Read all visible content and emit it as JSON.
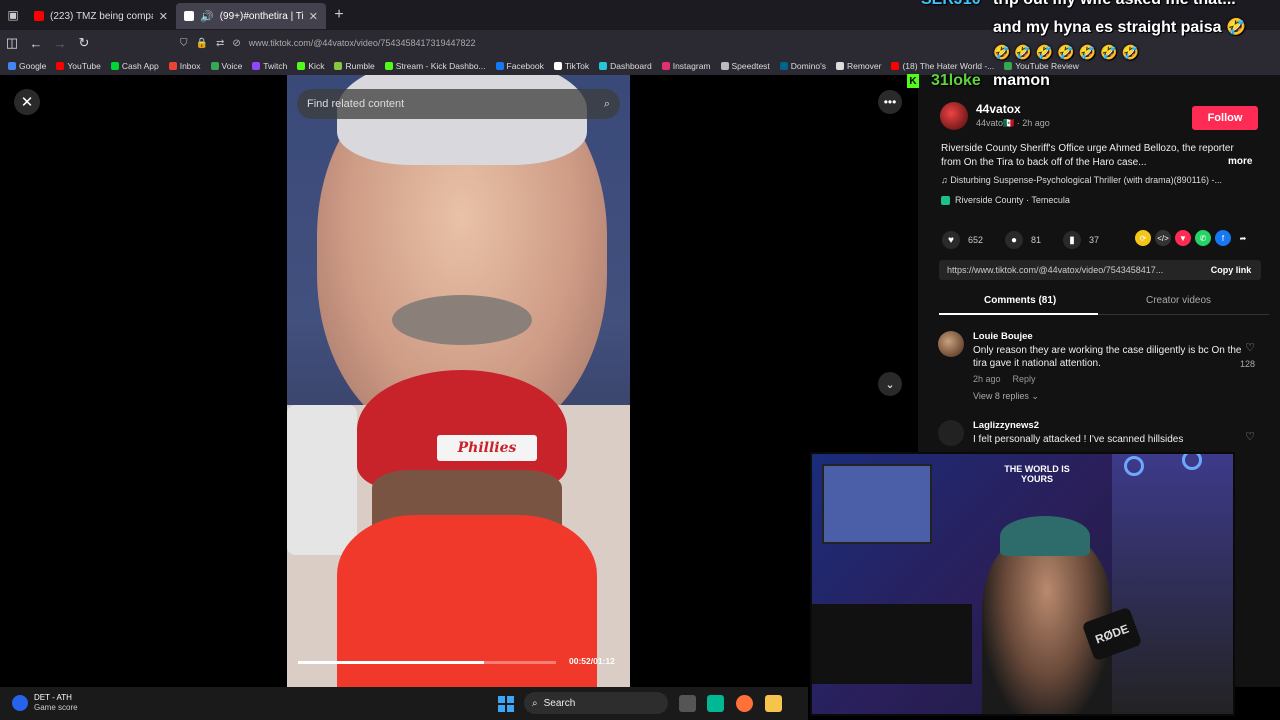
{
  "browser": {
    "tabs": [
      {
        "title": "(223) TMZ being compared to t",
        "active": false,
        "favicon_color": "#ff0000"
      },
      {
        "title": "(99+)#onthetira | TikTok",
        "active": true,
        "favicon_color": "#ffffff"
      }
    ],
    "url": "www.tiktok.com/@44vatox/video/7543458417319447822",
    "bookmarks": [
      {
        "label": "Google",
        "color": "#4285f4"
      },
      {
        "label": "YouTube",
        "color": "#ff0000"
      },
      {
        "label": "Cash App",
        "color": "#00d632"
      },
      {
        "label": "Inbox",
        "color": "#ea4335"
      },
      {
        "label": "Voice",
        "color": "#34a853"
      },
      {
        "label": "Twitch",
        "color": "#9146ff"
      },
      {
        "label": "Kick",
        "color": "#53fc18"
      },
      {
        "label": "Rumble",
        "color": "#85c742"
      },
      {
        "label": "Stream - Kick Dashbo...",
        "color": "#53fc18"
      },
      {
        "label": "Facebook",
        "color": "#1877f2"
      },
      {
        "label": "TikTok",
        "color": "#ffffff"
      },
      {
        "label": "Dashboard",
        "color": "#26c6da"
      },
      {
        "label": "Instagram",
        "color": "#e1306c"
      },
      {
        "label": "Speedtest",
        "color": "#bbbbbb"
      },
      {
        "label": "Domino's",
        "color": "#006491"
      },
      {
        "label": "Remover",
        "color": "#dddddd"
      },
      {
        "label": "(18) The Hater World -...",
        "color": "#ff0000"
      },
      {
        "label": "YouTube Review",
        "color": "#34a853"
      }
    ]
  },
  "video": {
    "search_placeholder": "Find related content",
    "cap_text": "Phillies",
    "time": "00:52/01:12",
    "progress": 0.72
  },
  "post": {
    "author": "44vatox",
    "meta": "44vato🇲🇽 · 2h ago",
    "follow_label": "Follow",
    "description": "Riverside County Sheriff's Office urge Ahmed Bellozo, the reporter from On the Tira to back off of the Haro case...",
    "more_label": "more",
    "music": "♫  Disturbing Suspense-Psychological Thriller (with drama)(890116) -...",
    "location": "Riverside County · Temecula",
    "likes": "652",
    "comments": "81",
    "saves": "37",
    "link": "https://www.tiktok.com/@44vatox/video/7543458417...",
    "copy_label": "Copy link",
    "tab_comments": "Comments (81)",
    "tab_creator": "Creator videos"
  },
  "comments": [
    {
      "user": "Louie Boujee",
      "text": "Only reason they are working the case diligently is bc On the tira gave it national attention.",
      "time": "2h ago",
      "reply_label": "Reply",
      "replies": "View 8 replies ⌄",
      "likes": "128"
    },
    {
      "user": "Laglizzynews2",
      "text": "I felt personally attacked ! I've scanned hillsides",
      "time": "",
      "reply_label": "",
      "replies": "",
      "likes": ""
    }
  ],
  "chat": {
    "user1": "SERJ10",
    "line1": "trip out my wife asked me that...",
    "line2": "and my hyna es straight paisa 🤣",
    "emotes": "🤣🤣🤣🤣🤣🤣🤣",
    "user2": "31loke",
    "line3": "mamon"
  },
  "webcam": {
    "mic_label": "RØDE",
    "sign_text": "THE WORLD IS YOURS"
  },
  "taskbar": {
    "weather_title": "DET - ATH",
    "weather_sub": "Game score",
    "search_label": "Search"
  }
}
